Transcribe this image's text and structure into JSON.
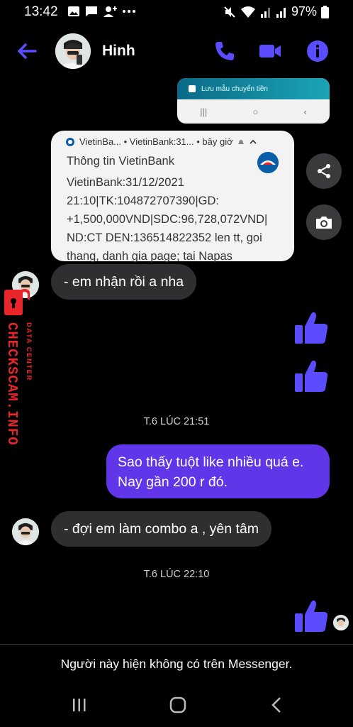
{
  "status_bar": {
    "time": "13:42",
    "battery": "97%",
    "icons_left": [
      "image-icon",
      "message-icon",
      "person-add-icon",
      "more-icon"
    ],
    "icons_right": [
      "mute-icon",
      "wifi-icon",
      "signal-icon",
      "signal-icon",
      "battery-icon"
    ]
  },
  "header": {
    "contact_name": "Hinh",
    "accent_color": "#5b4dff"
  },
  "shared_image": {
    "save_template_label": "Lưu mẫu chuyển tiền"
  },
  "sms_card": {
    "header": "VietinBa... • VietinBank:31... • bây giờ",
    "title": "Thông tin VietinBank",
    "lines": [
      "VietinBank:31/12/2021",
      "21:10|TK:104872707390|GD:",
      "+1,500,000VND|SDC:96,728,072VND|",
      "ND:CT DEN:136514822352 len tt, goi",
      "thang, danh gia page; tai Napas"
    ]
  },
  "messages": {
    "received_1": "- em nhận rồi a nha",
    "timestamp_1": "T.6 LÚC 21:51",
    "sent_1": "Sao thấy tuột like nhiều quá e.  Nay gần 200 r đó.",
    "received_2": "- đợi em làm combo a , yên tâm",
    "timestamp_2": "T.6 LÚC 22:10"
  },
  "watermark": {
    "brand": "CHECKSCAM.INFO",
    "sub": "DATA CENTER"
  },
  "footer": {
    "notice": "Người này hiện không có trên Messenger."
  },
  "colors": {
    "sent_bubble": "#6135e8",
    "received_bubble": "#2f2f31",
    "like": "#5b4dff",
    "watermark": "#e8262a"
  }
}
